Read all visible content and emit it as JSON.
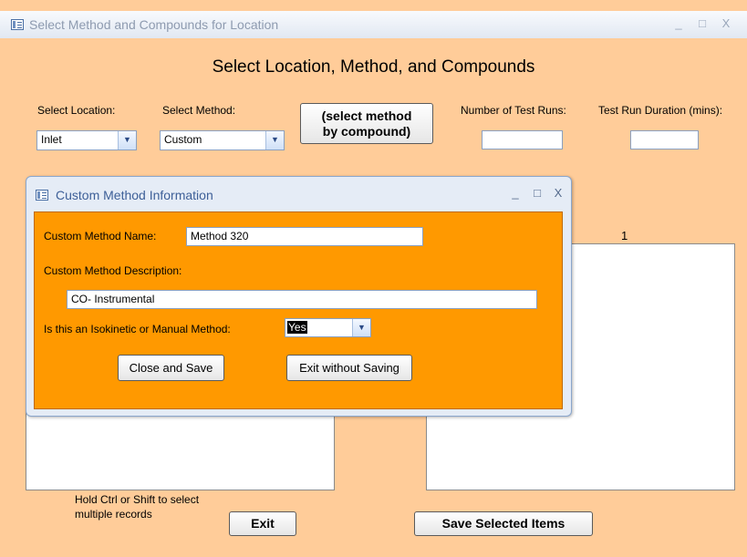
{
  "window": {
    "title": "Select Method and Compounds for Location",
    "controls": [
      "_",
      "□",
      "X"
    ]
  },
  "form": {
    "heading": "Select Location, Method, and Compounds",
    "location_label": "Select Location:",
    "location_value": "Inlet",
    "method_label": "Select Method:",
    "method_value": "Custom",
    "compound_button_line1": "(select method",
    "compound_button_line2": "by compound)",
    "test_runs_label": "Number of Test Runs:",
    "test_runs_value": "",
    "duration_label": "Test Run Duration (mins):",
    "duration_value": "",
    "column_number": "1",
    "hint_line1": "Hold Ctrl or Shift to select",
    "hint_line2": "multiple records",
    "exit_button": "Exit",
    "save_button": "Save Selected Items"
  },
  "popup": {
    "title": "Custom Method Information",
    "controls": [
      "_",
      "□",
      "X"
    ],
    "name_label": "Custom Method Name:",
    "name_value": "Method 320",
    "description_label": "Custom Method Description:",
    "description_value": "CO- Instrumental",
    "isokinetic_label": "Is this an Isokinetic or Manual  Method:",
    "isokinetic_value": "Yes",
    "close_save_button": "Close and Save",
    "exit_no_save_button": "Exit without Saving"
  },
  "colors": {
    "form_background": "#ffcc99",
    "popup_background": "#ff9900",
    "title_bar": "#e1e8f2"
  }
}
